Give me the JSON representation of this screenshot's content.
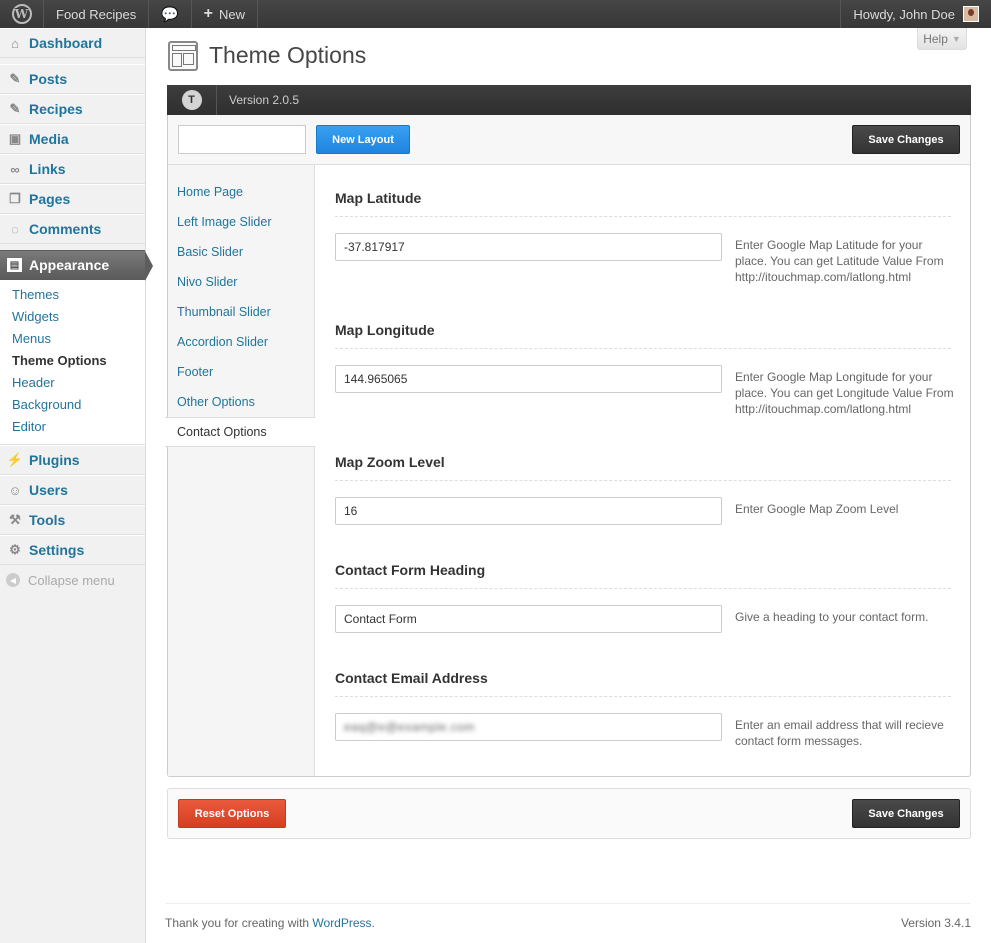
{
  "adminbar": {
    "site_name": "Food Recipes",
    "new_label": "New",
    "greeting": "Howdy, John Doe"
  },
  "sidebar": {
    "items": [
      {
        "label": "Dashboard",
        "icon": "dashboard-icon"
      },
      {
        "label": "Posts",
        "icon": "pin-icon"
      },
      {
        "label": "Recipes",
        "icon": "pin-icon"
      },
      {
        "label": "Media",
        "icon": "media-icon"
      },
      {
        "label": "Links",
        "icon": "link-icon"
      },
      {
        "label": "Pages",
        "icon": "pages-icon"
      },
      {
        "label": "Comments",
        "icon": "comment-icon"
      },
      {
        "label": "Appearance",
        "icon": "appearance-icon"
      },
      {
        "label": "Plugins",
        "icon": "plugin-icon"
      },
      {
        "label": "Users",
        "icon": "users-icon"
      },
      {
        "label": "Tools",
        "icon": "tools-icon"
      },
      {
        "label": "Settings",
        "icon": "settings-icon"
      }
    ],
    "appearance_submenu": [
      "Themes",
      "Widgets",
      "Menus",
      "Theme Options",
      "Header",
      "Background",
      "Editor"
    ],
    "collapse_label": "Collapse menu"
  },
  "page": {
    "title": "Theme Options",
    "help_label": "Help"
  },
  "panel": {
    "logo_letter": "T",
    "version": "Version 2.0.5",
    "search_value": "",
    "new_layout_label": "New Layout",
    "save_label": "Save Changes",
    "nav": [
      "Home Page",
      "Left Image Slider",
      "Basic Slider",
      "Nivo Slider",
      "Thumbnail Slider",
      "Accordion Slider",
      "Footer",
      "Other Options",
      "Contact Options"
    ],
    "fields": [
      {
        "label": "Map Latitude",
        "value": "-37.817917",
        "desc": "Enter Google Map Latitude for your place. You can get Latitude Value From http://itouchmap.com/latlong.html"
      },
      {
        "label": "Map Longitude",
        "value": "144.965065",
        "desc": "Enter Google Map Longitude for your place. You can get Longitude Value From http://itouchmap.com/latlong.html"
      },
      {
        "label": "Map Zoom Level",
        "value": "16",
        "desc": "Enter Google Map Zoom Level"
      },
      {
        "label": "Contact Form Heading",
        "value": "Contact Form",
        "desc": "Give a heading to your contact form."
      },
      {
        "label": "Contact Email Address",
        "value": "eaq@e@example.com",
        "desc": "Enter an email address that will recieve contact form messages."
      }
    ],
    "reset_label": "Reset Options"
  },
  "footer": {
    "credit_prefix": "Thank you for creating with ",
    "credit_link": "WordPress",
    "credit_suffix": ".",
    "version": "Version 3.4.1"
  },
  "colors": {
    "link": "#21759b",
    "blue_button": "#1e85e0",
    "red_button": "#d63e22",
    "dark_button": "#333333"
  }
}
